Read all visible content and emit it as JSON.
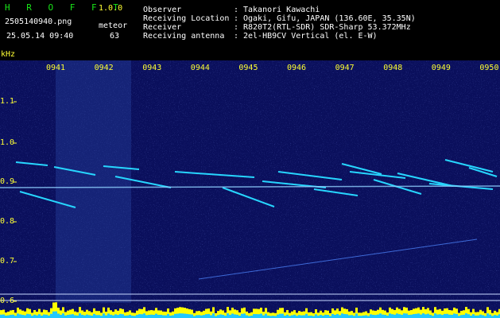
{
  "app": {
    "name": "H R O F F T",
    "version": "1.0.0"
  },
  "file": {
    "name": "2505140940.png",
    "datetime": "25.05.14 09:40"
  },
  "counter": {
    "label": "meteor",
    "value": "63"
  },
  "info": [
    {
      "label": "Observer",
      "sep": ":",
      "value": "Takanori Kawachi"
    },
    {
      "label": "Receiving Location",
      "sep": ":",
      "value": "Ogaki, Gifu, JAPAN (136.60E, 35.35N)"
    },
    {
      "label": "Receiver",
      "sep": ":",
      "value": "R820T2(RTL-SDR) SDR-Sharp 53.372MHz"
    },
    {
      "label": "Receiving antenna",
      "sep": ":",
      "value": "2el-HB9CV Vertical (el. E-W)"
    }
  ],
  "y_axis": {
    "unit": "kHz",
    "ticks": [
      "1.1",
      "1.0",
      "0.9",
      "0.8",
      "0.7",
      "0.6"
    ]
  },
  "x_axis": {
    "ticks": [
      "0941",
      "0942",
      "0943",
      "0944",
      "0945",
      "0946",
      "0947",
      "0948",
      "0949",
      "0950"
    ]
  },
  "colors": {
    "background": "#000000",
    "plot_bg": "#0a0f5c",
    "tick_label": "#ffff33",
    "title": "#19e619",
    "echo_line": "#27d6ff",
    "carrier": "#ffdf40",
    "spectrum_bar_top": "#ffff00",
    "spectrum_bar_base": "#22c8ff"
  }
}
